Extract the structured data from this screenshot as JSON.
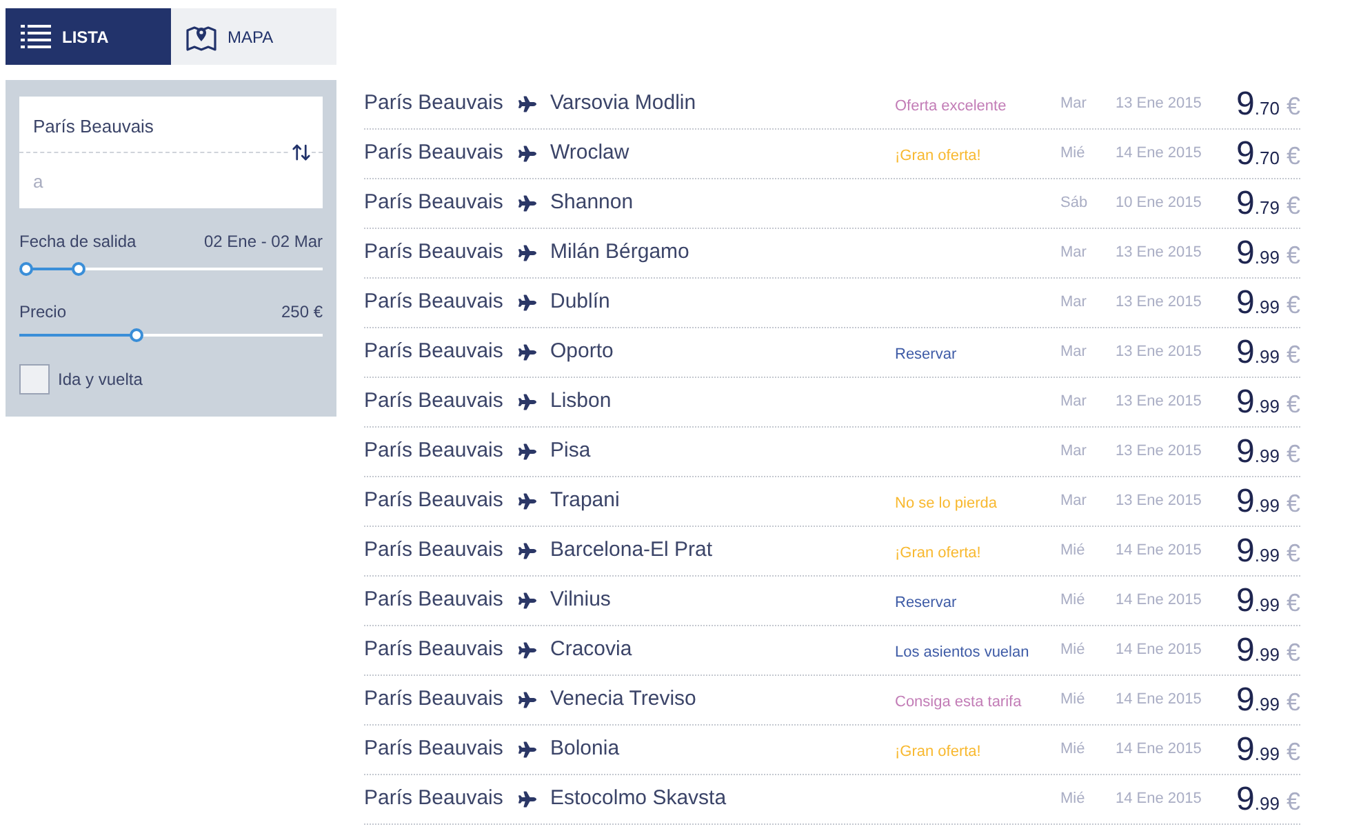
{
  "view_tabs": [
    {
      "label": "LISTA",
      "selected": true
    },
    {
      "label": "MAPA",
      "selected": false
    }
  ],
  "filters": {
    "origin": {
      "value": "París Beauvais"
    },
    "destination": {
      "placeholder": "a"
    },
    "departure_date": {
      "label": "Fecha de salida",
      "value": "02 Ene - 02 Mar",
      "handles": [
        {
          "level": 0
        },
        {
          "level": 0.18
        }
      ]
    },
    "price": {
      "label": "Precio",
      "value": "250 €",
      "level": 0.38
    },
    "round_trip": {
      "label": "Ida y vuelta",
      "checked": false
    }
  },
  "flights": [
    {
      "origin": "París Beauvais",
      "destination": "Varsovia Modlin",
      "tag": {
        "text": "Oferta excelente",
        "color": "#c27cb6"
      },
      "day": "Mar",
      "date": "13 Ene 2015",
      "price": {
        "whole": "9",
        "cents": ".70",
        "currency": "€"
      }
    },
    {
      "origin": "París Beauvais",
      "destination": "Wroclaw",
      "tag": {
        "text": "¡Gran oferta!",
        "color": "#f8b82e"
      },
      "day": "Mié",
      "date": "14 Ene 2015",
      "price": {
        "whole": "9",
        "cents": ".70",
        "currency": "€"
      }
    },
    {
      "origin": "París Beauvais",
      "destination": "Shannon",
      "day": "Sáb",
      "date": "10 Ene 2015",
      "price": {
        "whole": "9",
        "cents": ".79",
        "currency": "€"
      }
    },
    {
      "origin": "París Beauvais",
      "destination": "Milán Bérgamo",
      "day": "Mar",
      "date": "13 Ene 2015",
      "price": {
        "whole": "9",
        "cents": ".99",
        "currency": "€"
      }
    },
    {
      "origin": "París Beauvais",
      "destination": "Dublín",
      "day": "Mar",
      "date": "13 Ene 2015",
      "price": {
        "whole": "9",
        "cents": ".99",
        "currency": "€"
      }
    },
    {
      "origin": "París Beauvais",
      "destination": "Oporto",
      "tag": {
        "text": "Reservar",
        "color": "#3e5ba6"
      },
      "day": "Mar",
      "date": "13 Ene 2015",
      "price": {
        "whole": "9",
        "cents": ".99",
        "currency": "€"
      }
    },
    {
      "origin": "París Beauvais",
      "destination": "Lisbon",
      "day": "Mar",
      "date": "13 Ene 2015",
      "price": {
        "whole": "9",
        "cents": ".99",
        "currency": "€"
      }
    },
    {
      "origin": "París Beauvais",
      "destination": "Pisa",
      "day": "Mar",
      "date": "13 Ene 2015",
      "price": {
        "whole": "9",
        "cents": ".99",
        "currency": "€"
      }
    },
    {
      "origin": "París Beauvais",
      "destination": "Trapani",
      "tag": {
        "text": "No se lo pierda",
        "color": "#f8b82e"
      },
      "day": "Mar",
      "date": "13 Ene 2015",
      "price": {
        "whole": "9",
        "cents": ".99",
        "currency": "€"
      }
    },
    {
      "origin": "París Beauvais",
      "destination": "Barcelona-El Prat",
      "tag": {
        "text": "¡Gran oferta!",
        "color": "#f8b82e"
      },
      "day": "Mié",
      "date": "14 Ene 2015",
      "price": {
        "whole": "9",
        "cents": ".99",
        "currency": "€"
      }
    },
    {
      "origin": "París Beauvais",
      "destination": "Vilnius",
      "tag": {
        "text": "Reservar",
        "color": "#3e5ba6"
      },
      "day": "Mié",
      "date": "14 Ene 2015",
      "price": {
        "whole": "9",
        "cents": ".99",
        "currency": "€"
      }
    },
    {
      "origin": "París Beauvais",
      "destination": "Cracovia",
      "tag": {
        "text": "Los asientos vuelan",
        "color": "#3e5ba6"
      },
      "day": "Mié",
      "date": "14 Ene 2015",
      "price": {
        "whole": "9",
        "cents": ".99",
        "currency": "€"
      }
    },
    {
      "origin": "París Beauvais",
      "destination": "Venecia Treviso",
      "tag": {
        "text": "Consiga esta tarifa",
        "color": "#c27cb6"
      },
      "day": "Mié",
      "date": "14 Ene 2015",
      "price": {
        "whole": "9",
        "cents": ".99",
        "currency": "€"
      }
    },
    {
      "origin": "París Beauvais",
      "destination": "Bolonia",
      "tag": {
        "text": "¡Gran oferta!",
        "color": "#f8b82e"
      },
      "day": "Mié",
      "date": "14 Ene 2015",
      "price": {
        "whole": "9",
        "cents": ".99",
        "currency": "€"
      }
    },
    {
      "origin": "París Beauvais",
      "destination": "Estocolmo Skavsta",
      "day": "Mié",
      "date": "14 Ene 2015",
      "price": {
        "whole": "9",
        "cents": ".99",
        "currency": "€"
      }
    }
  ]
}
